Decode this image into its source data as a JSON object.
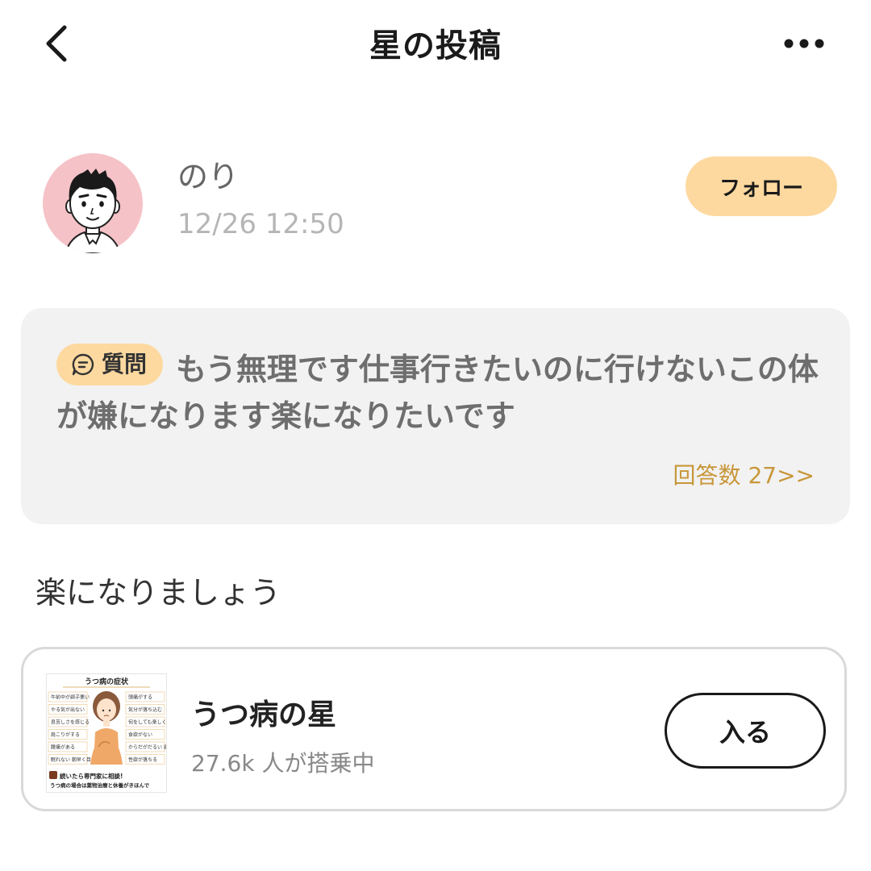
{
  "header": {
    "title": "星の投稿",
    "back_icon": "chevron-left-icon",
    "more_icon": "more-horizontal-icon"
  },
  "post": {
    "username": "のり",
    "timestamp": "12/26 12:50",
    "follow_label": "フォロー",
    "avatar_icon": "avatar-icon"
  },
  "question": {
    "badge_label": "質問",
    "badge_icon": "chat-bubble-icon",
    "text": "もう無理です仕事行きたいのに行けないこの体が嫌になります楽になりたいです",
    "answer_count_label": "回答数 27>>"
  },
  "answer": {
    "text": "楽になりましょう"
  },
  "community": {
    "name": "うつ病の星",
    "stats": "27.6k 人が搭乗中",
    "join_label": "入る",
    "thumbnail": {
      "title": "うつ病の症状",
      "left_items": [
        "午前中が調子悪い",
        "やる気が出ない",
        "息苦しさを感じる",
        "肩こりがする",
        "腰痛がある",
        "眠れない 朝早く目が覚める"
      ],
      "right_items": [
        "頭痛がする",
        "気分が落ち込む",
        "何をしても楽しくない",
        "食欲がない",
        "からだがだるい 疲れやすい",
        "性欲が落ちる"
      ],
      "footer_line1": "続いたら専門家に相談!",
      "footer_line2": "うつ病の場合は薬物治療と休養がきほんで"
    }
  },
  "colors": {
    "accent": "#fdd9a0",
    "link": "#c8973a",
    "card_bg": "#f2f2f2",
    "avatar_bg": "#f5c2c7"
  }
}
